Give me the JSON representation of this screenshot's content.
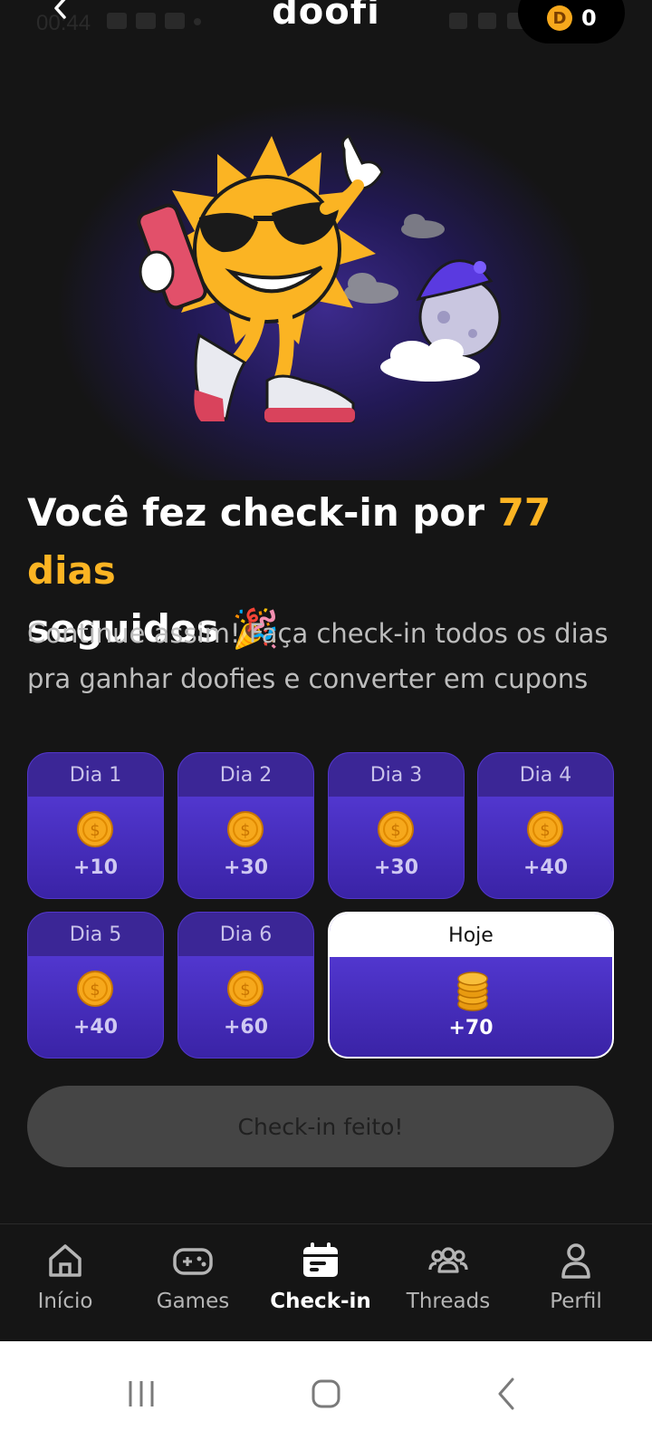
{
  "status_bar": {
    "time": "00:44"
  },
  "header": {
    "back_icon": "chevron-left-icon",
    "brand": "doofi",
    "coin_symbol": "D",
    "coin_balance": "0"
  },
  "headline": {
    "prefix": "Você fez check-in por ",
    "highlight": "77 dias",
    "suffix": "seguidos",
    "emoji": "🎉",
    "accent_color": "#fbb423"
  },
  "subtext": "Continue assim! Faça check-in todos os dias pra ganhar doofies e converter em cupons",
  "days": [
    {
      "label": "Dia 1",
      "points": "+10"
    },
    {
      "label": "Dia 2",
      "points": "+30"
    },
    {
      "label": "Dia 3",
      "points": "+30"
    },
    {
      "label": "Dia 4",
      "points": "+40"
    },
    {
      "label": "Dia 5",
      "points": "+40"
    },
    {
      "label": "Dia 6",
      "points": "+60"
    }
  ],
  "today": {
    "label": "Hoje",
    "points": "+70"
  },
  "checkin_button": "Check-in feito!",
  "nav": [
    {
      "label": "Início",
      "icon": "home-icon"
    },
    {
      "label": "Games",
      "icon": "gamepad-icon"
    },
    {
      "label": "Check-in",
      "icon": "calendar-icon",
      "active": true
    },
    {
      "label": "Threads",
      "icon": "users-icon"
    },
    {
      "label": "Perfil",
      "icon": "user-icon"
    }
  ],
  "colors": {
    "background": "#151515",
    "card_purple": "#5b3fe0",
    "accent": "#fbb423"
  }
}
